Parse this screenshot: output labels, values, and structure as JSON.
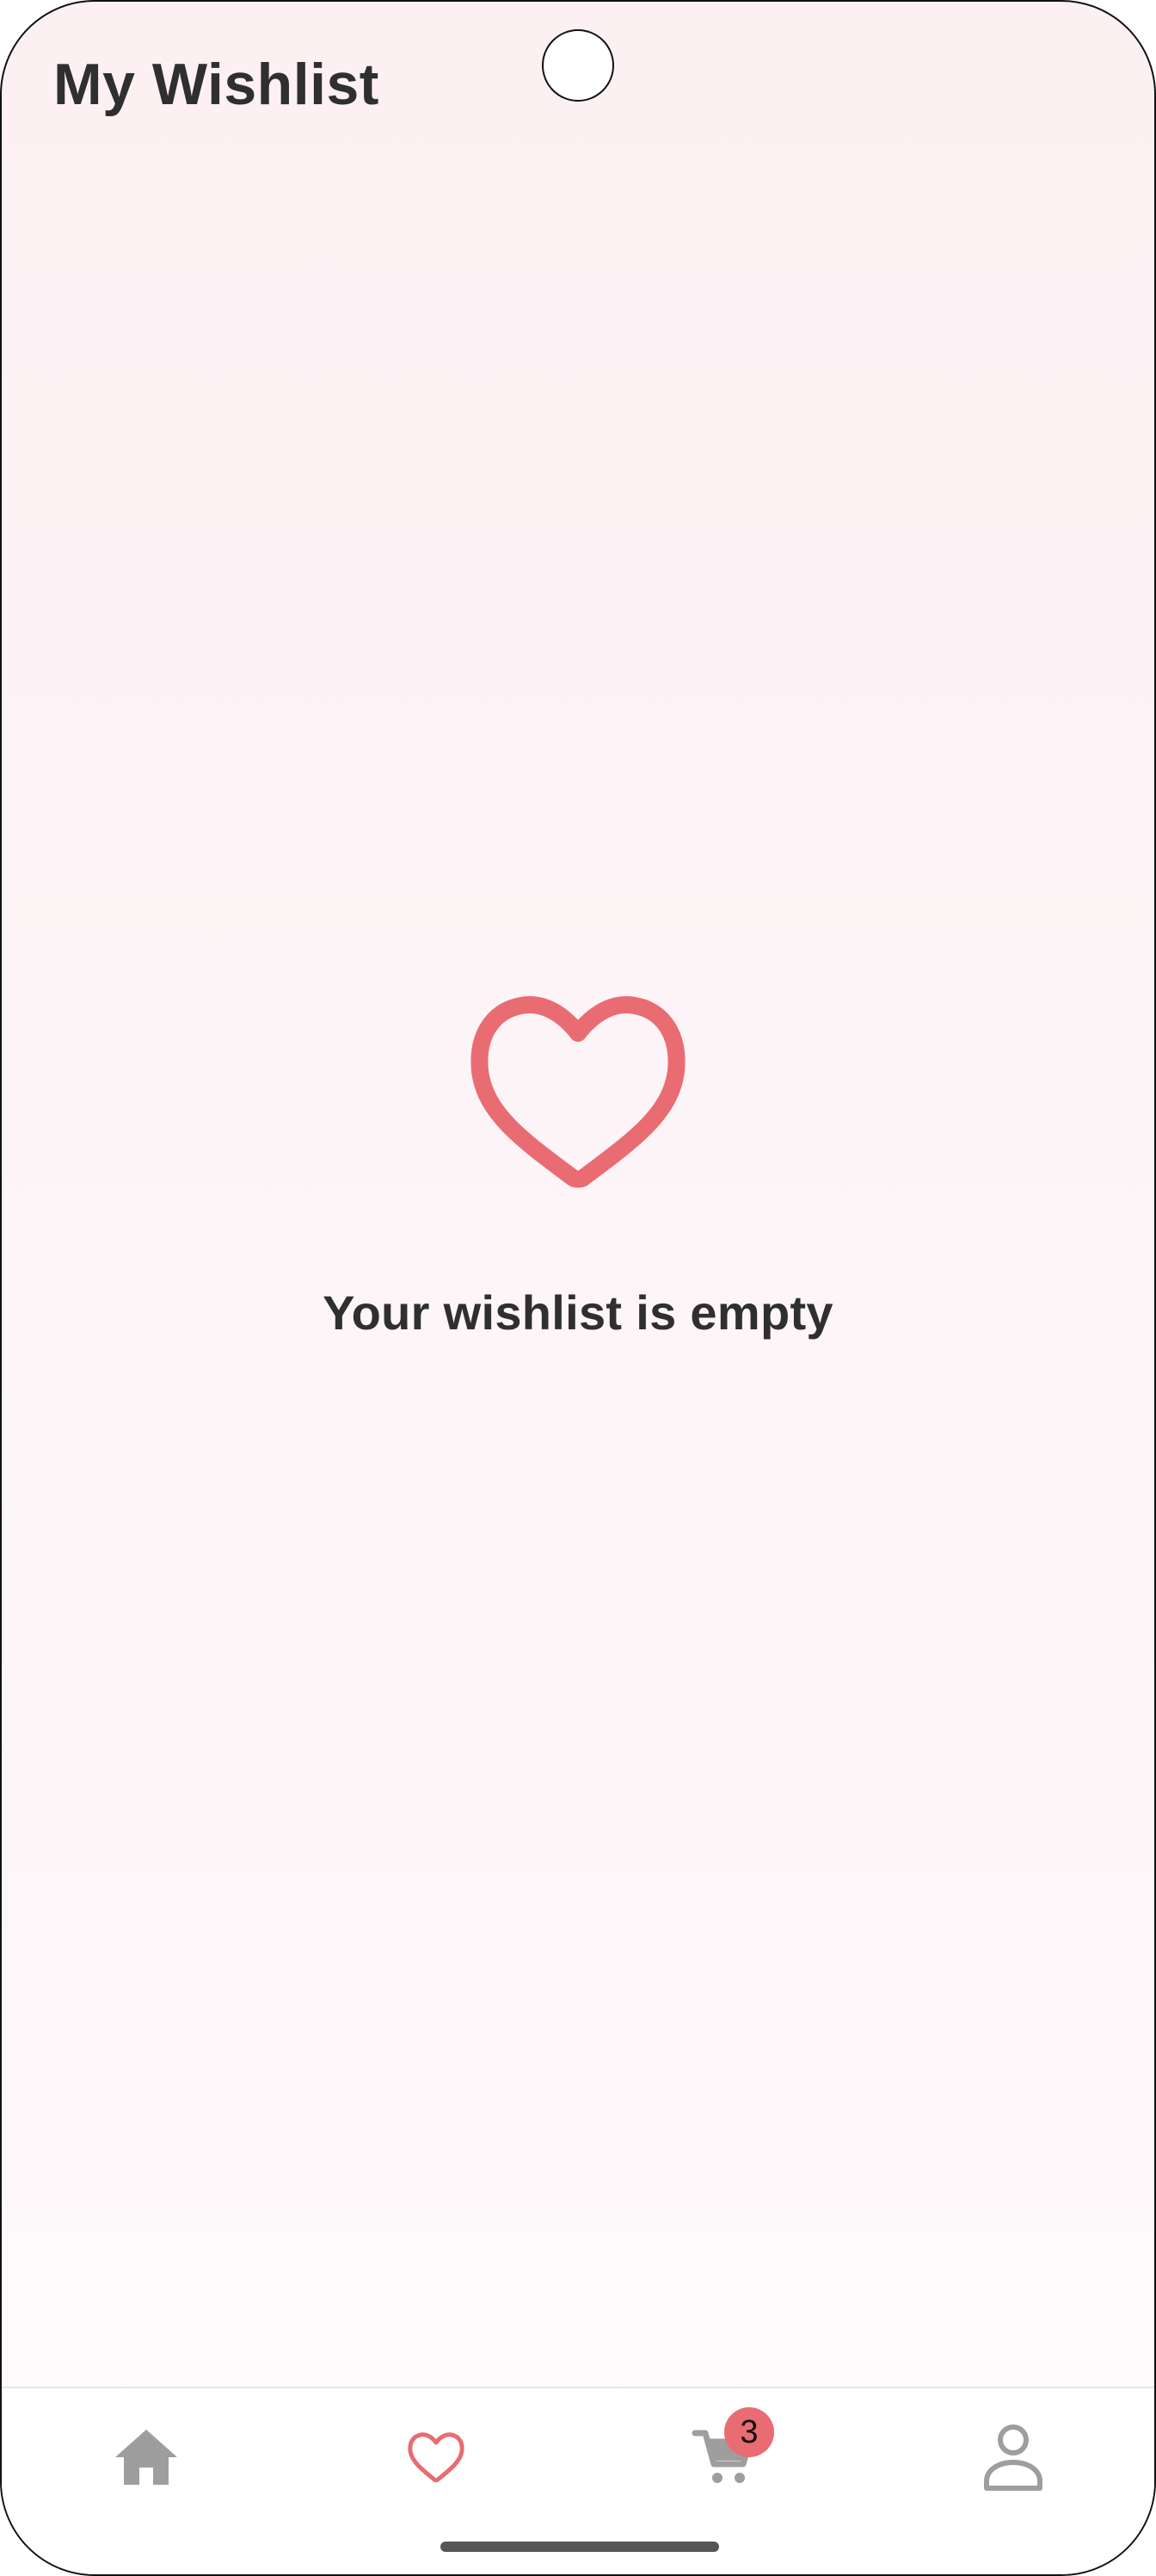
{
  "header": {
    "title": "My Wishlist"
  },
  "empty_state": {
    "message": "Your wishlist is empty",
    "icon": "heart-outline-icon"
  },
  "bottom_nav": {
    "items": [
      {
        "icon": "home-icon",
        "active": false
      },
      {
        "icon": "heart-icon",
        "active": true
      },
      {
        "icon": "cart-icon",
        "active": false,
        "badge": "3"
      },
      {
        "icon": "profile-icon",
        "active": false
      }
    ]
  },
  "colors": {
    "accent": "#e96c72",
    "text": "#2f2f2f",
    "inactive_icon": "#9e9e9e",
    "background_top": "#fcf0f2",
    "background_bottom": "#fefafc"
  }
}
